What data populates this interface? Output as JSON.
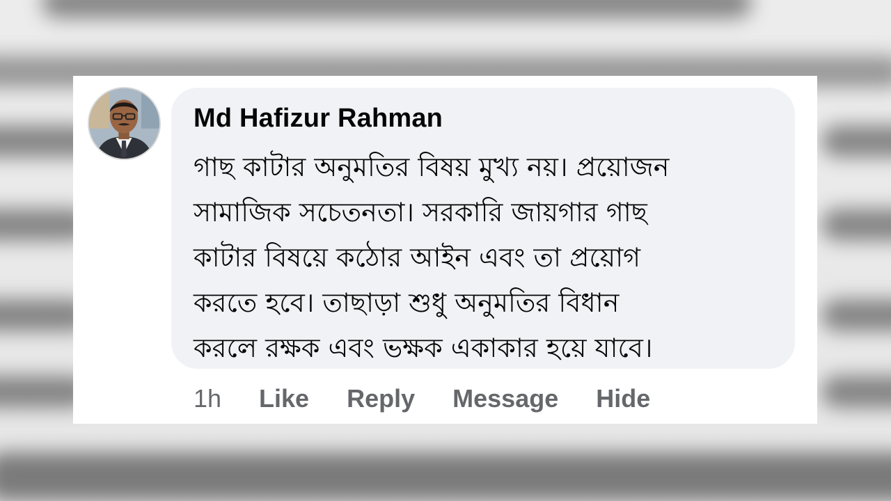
{
  "comment": {
    "author": "Md Hafizur Rahman",
    "text": "গাছ কাটার অনুমতির বিষয় মুখ্য নয়। প্রয়োজন\nসামাজিক সচেতনতা। সরকারি জায়গার গাছ\nকাটার বিষয়ে কঠোর আইন এবং তা প্রয়োগ\nকরতে হবে। তাছাড়া শুধু অনুমতির বিধান\nকরলে রক্ষক এবং ভক্ষক একাকার হয়ে যাবে।",
    "avatar_icon": "profile-photo"
  },
  "actions": {
    "time": "1h",
    "like": "Like",
    "reply": "Reply",
    "message": "Message",
    "hide": "Hide"
  },
  "colors": {
    "bubble": "#f0f2f5",
    "text": "#050505",
    "action_text": "#65676b",
    "card": "#ffffff"
  }
}
